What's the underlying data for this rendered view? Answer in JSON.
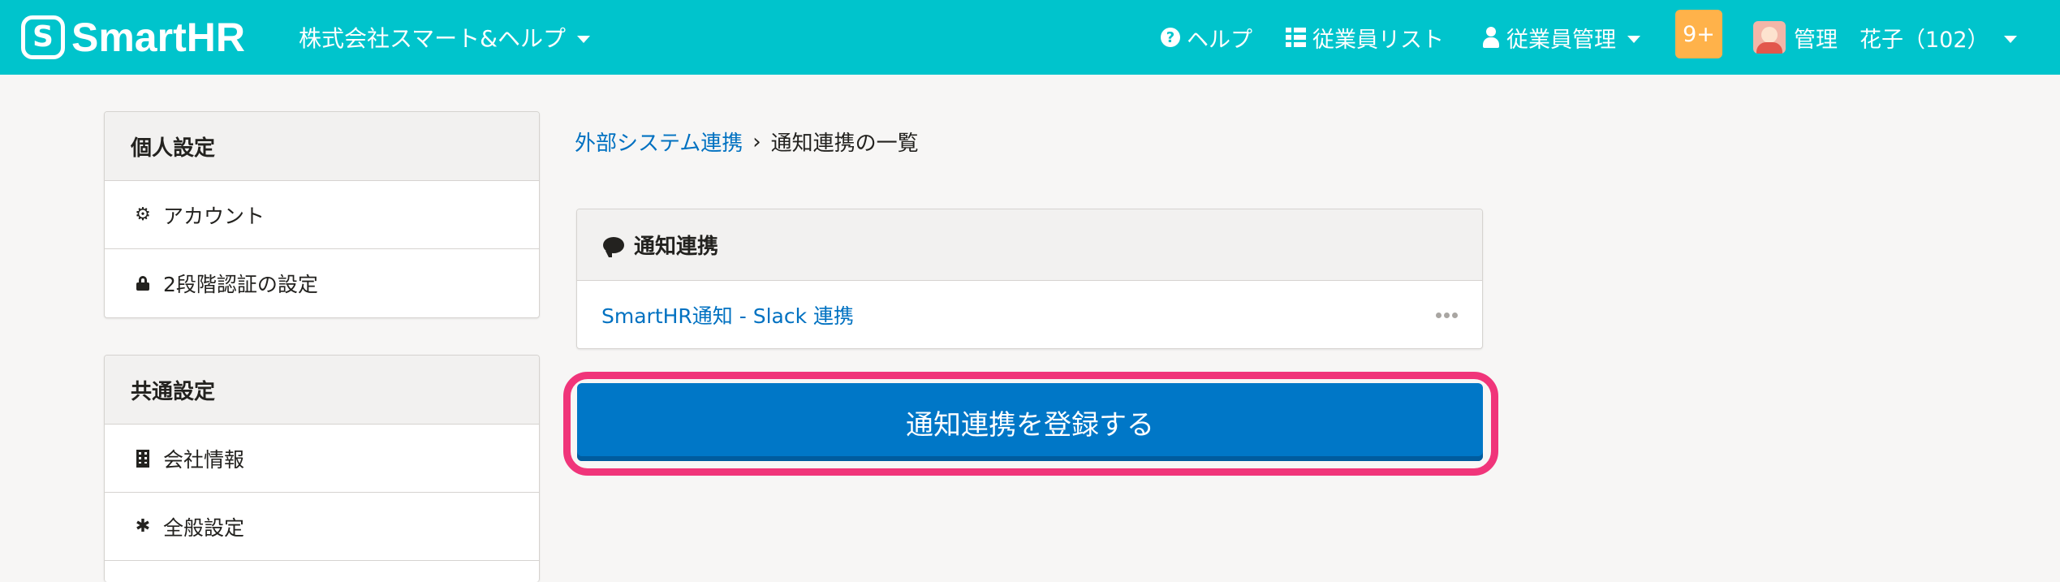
{
  "header": {
    "logo_text": "SmartHR",
    "logo_mark": "S",
    "company": "株式会社スマート&ヘルプ",
    "help_label": "ヘルプ",
    "employee_list_label": "従業員リスト",
    "employee_mgmt_label": "従業員管理",
    "notification_count": "9+",
    "user_name": "管理　花子（102）"
  },
  "sidebar": {
    "personal": {
      "title": "個人設定",
      "items": [
        {
          "label": "アカウント",
          "icon": "gear-icon"
        },
        {
          "label": "2段階認証の設定",
          "icon": "lock-icon"
        }
      ]
    },
    "common": {
      "title": "共通設定",
      "items": [
        {
          "label": "会社情報",
          "icon": "building-icon"
        },
        {
          "label": "全般設定",
          "icon": "asterisk-icon"
        }
      ]
    }
  },
  "breadcrumb": {
    "parent": "外部システム連携",
    "current": "通知連携の一覧"
  },
  "card": {
    "title": "通知連携",
    "items": [
      {
        "label": "SmartHR通知 - Slack 連携"
      }
    ]
  },
  "register_button_label": "通知連携を登録する",
  "colors": {
    "header": "#00c4cc",
    "primary": "#0077c7",
    "highlight": "#f0357a",
    "notification": "#ffb24a",
    "link": "#0071c1"
  }
}
